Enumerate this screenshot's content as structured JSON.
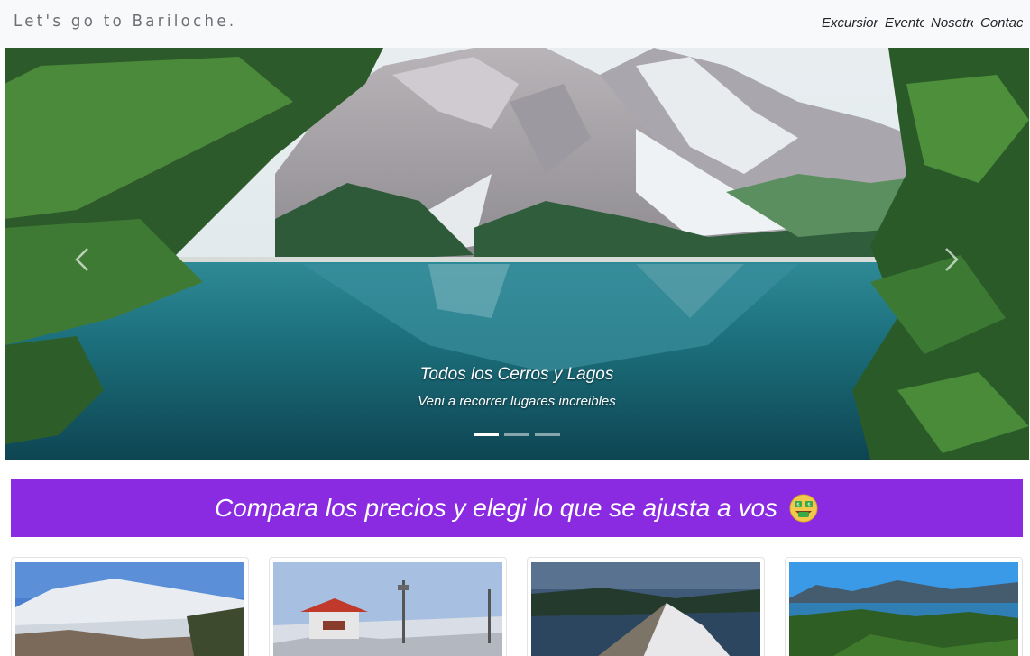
{
  "navbar": {
    "brand": "Let's go to Bariloche.",
    "links": [
      "Excursiones",
      "Eventos",
      "Nosotros",
      "Contacto"
    ]
  },
  "carousel": {
    "title": "Todos los Cerros y Lagos",
    "subtitle": "Veni a recorrer lugares increibles",
    "slide_count": 3,
    "active_slide": 1,
    "prev_icon": "chevron-left-icon",
    "next_icon": "chevron-right-icon"
  },
  "banner": {
    "text": "Compara los precios y elegi lo que se ajusta a vos",
    "emoji_icon": "money-mouth-face-icon",
    "color": "#8a2be2"
  },
  "cards": [
    {
      "image": "snowy-hill-village"
    },
    {
      "image": "mountain-summit-station"
    },
    {
      "image": "rocky-peak-over-lakes"
    },
    {
      "image": "lake-district-panorama"
    }
  ]
}
